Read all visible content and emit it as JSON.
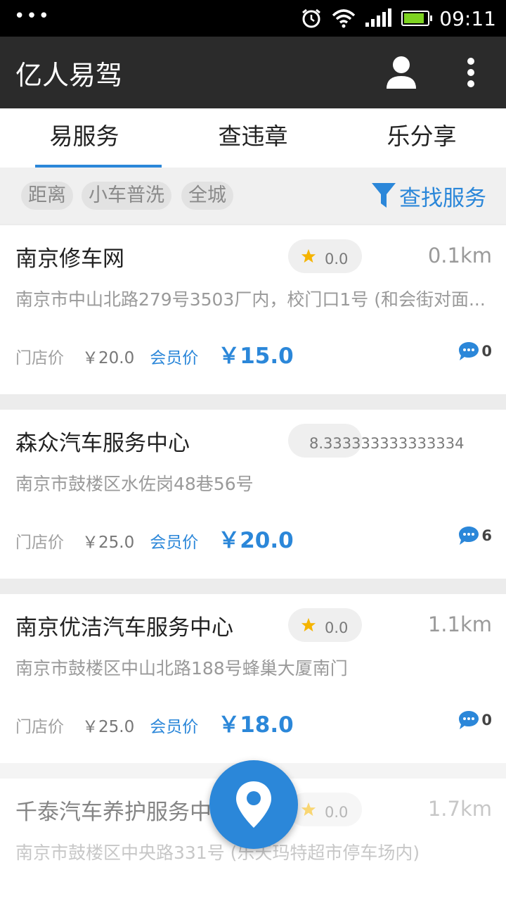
{
  "status_bar": {
    "time": "09:11",
    "left_dots": "•••",
    "icons": [
      "alarm-icon",
      "wifi-icon",
      "signal-icon",
      "battery-icon"
    ]
  },
  "app_bar": {
    "title": "亿人易驾",
    "icons": [
      "user-icon",
      "more-vert-icon"
    ]
  },
  "tabs": [
    {
      "label": "易服务",
      "active": true
    },
    {
      "label": "查违章",
      "active": false
    },
    {
      "label": "乐分享",
      "active": false
    }
  ],
  "filters": {
    "chips": [
      "距离",
      "小车普洗",
      "全城"
    ],
    "find_label": "查找服务",
    "find_icon": "filter-icon"
  },
  "labels": {
    "store_price": "门店价",
    "member_price": "会员价"
  },
  "listings": [
    {
      "name": "南京修车网",
      "rating": "0.0",
      "distance": "0.1km",
      "address": "南京市中山北路279号3503厂内，校门口1号 (和会街对面...",
      "store_price": "￥20.0",
      "member_price": "￥15.0",
      "comments": "0"
    },
    {
      "name": "森众汽车服务中心",
      "rating": "8.333333333333334",
      "distance": "",
      "address": "南京市鼓楼区水佐岗48巷56号",
      "store_price": "￥25.0",
      "member_price": "￥20.0",
      "comments": "6"
    },
    {
      "name": "南京优洁汽车服务中心",
      "rating": "0.0",
      "distance": "1.1km",
      "address": "南京市鼓楼区中山北路188号蜂巢大厦南门",
      "store_price": "￥25.0",
      "member_price": "￥18.0",
      "comments": "0"
    },
    {
      "name": "千泰汽车养护服务中心",
      "rating": "0.0",
      "distance": "1.7km",
      "address": "南京市鼓楼区中央路331号 (乐天玛特超市停车场内)",
      "store_price": "",
      "member_price": "",
      "comments": ""
    }
  ],
  "fab": {
    "icon": "location-pin-icon"
  },
  "colors": {
    "accent": "#2b87d9",
    "appbar": "#2b2b2b",
    "star": "#f5b400"
  }
}
